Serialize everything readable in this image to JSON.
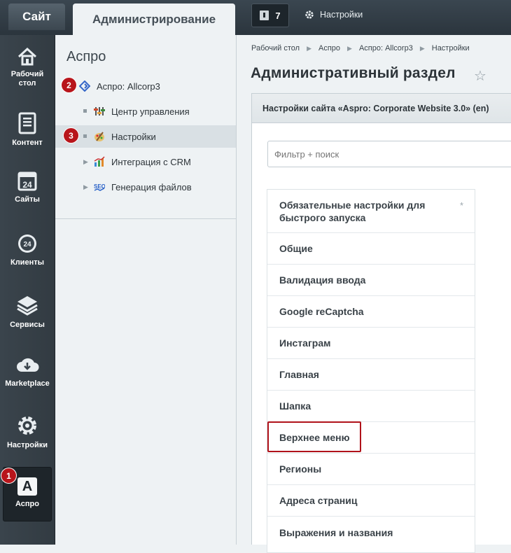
{
  "topbar": {
    "tab_site": "Сайт",
    "tab_admin": "Администрирование",
    "notifications_count": "7",
    "settings_label": "Настройки"
  },
  "leftnav": {
    "items": [
      {
        "label": "Рабочий стол",
        "icon": "home-icon"
      },
      {
        "label": "Контент",
        "icon": "document-icon"
      },
      {
        "label": "Сайты",
        "icon": "calendar-24-icon"
      },
      {
        "label": "Клиенты",
        "icon": "clients-24-icon"
      },
      {
        "label": "Сервисы",
        "icon": "layers-icon"
      },
      {
        "label": "Marketplace",
        "icon": "cloud-download-icon"
      },
      {
        "label": "Настройки",
        "icon": "gear-icon"
      },
      {
        "label": "Аспро",
        "icon": "aspro-icon",
        "glyph": "A"
      }
    ]
  },
  "tree": {
    "title": "Аспро",
    "items": [
      {
        "label": "Аспро: Allcorp3"
      },
      {
        "label": "Центр управления"
      },
      {
        "label": "Настройки"
      },
      {
        "label": "Интеграция с CRM"
      },
      {
        "label": "Генерация файлов"
      }
    ]
  },
  "badges": {
    "b1": "1",
    "b2": "2",
    "b3": "3"
  },
  "main": {
    "breadcrumbs": [
      "Рабочий стол",
      "Аспро",
      "Аспро: Allcorp3",
      "Настройки"
    ],
    "title": "Административный раздел",
    "settings_tab": "Настройки сайта «Aspro: Corporate Website 3.0» (en)",
    "filter_placeholder": "Фильтр + поиск",
    "sections": [
      "Обязательные настройки для быстрого запуска",
      "Общие",
      "Валидация ввода",
      "Google reCaptcha",
      "Инстаграм",
      "Главная",
      "Шапка",
      "Верхнее меню",
      "Регионы",
      "Адреса страниц",
      "Выражения и названия"
    ]
  },
  "colors": {
    "badge": "#b8151b",
    "highlight": "#b0121a",
    "nav_bg": "#3a444c"
  }
}
